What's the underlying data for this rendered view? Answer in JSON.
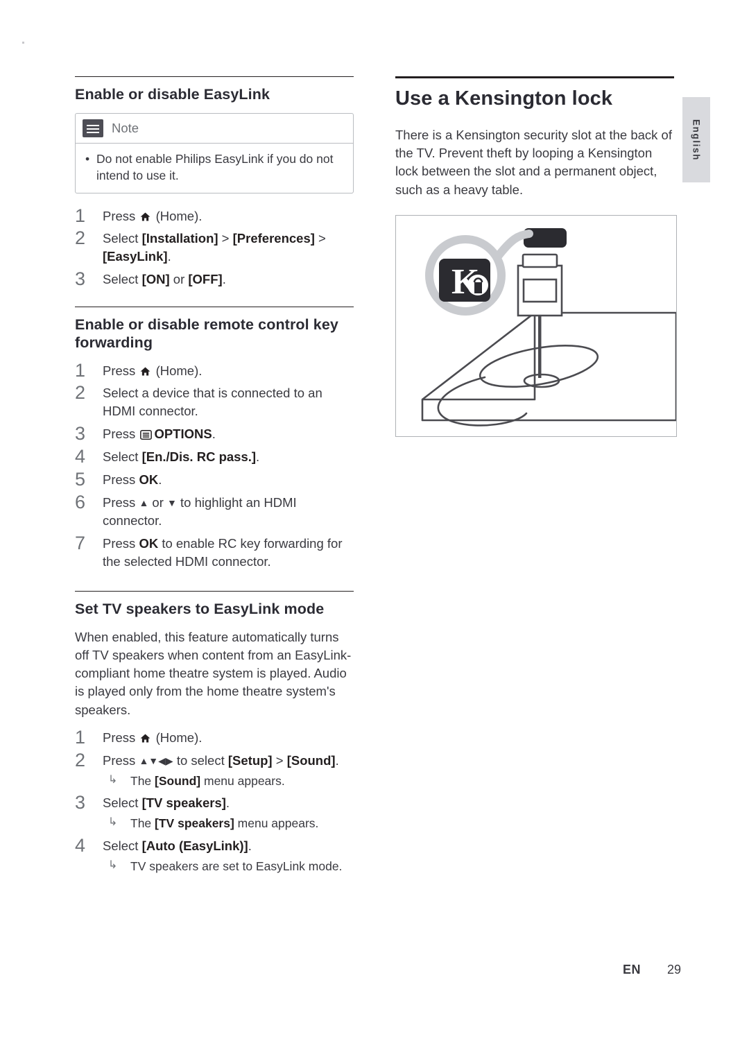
{
  "page": {
    "language_tab": "English",
    "footer_locale": "EN",
    "footer_page": "29"
  },
  "left_column": {
    "section1": {
      "heading": "Enable or disable EasyLink",
      "note": {
        "title": "Note",
        "bullet": "•",
        "items": [
          "Do not enable Philips EasyLink if you do not intend to use it."
        ]
      },
      "steps": [
        {
          "num": "1",
          "pre": "Press ",
          "icon": "home-icon",
          "post": " (Home)."
        },
        {
          "num": "2",
          "pre": "Select ",
          "bold1": "[Installation]",
          "mid1": " > ",
          "bold2": "[Preferences]",
          "mid2": " > ",
          "bold3": "[EasyLink]",
          "post": "."
        },
        {
          "num": "3",
          "pre": "Select ",
          "bold1": "[ON]",
          "mid1": " or ",
          "bold2": "[OFF]",
          "post": "."
        }
      ]
    },
    "section2": {
      "heading": "Enable or disable remote control key forwarding",
      "steps": [
        {
          "num": "1",
          "pre": "Press ",
          "icon": "home-icon",
          "post": " (Home)."
        },
        {
          "num": "2",
          "pre": "Select a device that is connected to an HDMI connector.",
          "post": ""
        },
        {
          "num": "3",
          "pre": "Press ",
          "icon": "options-icon",
          "bold1": "OPTIONS",
          "post": "."
        },
        {
          "num": "4",
          "pre": "Select ",
          "bold1": "[En./Dis. RC pass.]",
          "post": "."
        },
        {
          "num": "5",
          "pre": "Press ",
          "bold1": "OK",
          "post": "."
        },
        {
          "num": "6",
          "pre": "Press ",
          "icon": "up-down-arrows",
          "post": " to highlight an HDMI connector."
        },
        {
          "num": "7",
          "pre": "Press ",
          "bold1": "OK",
          "post": " to enable RC key forwarding for the selected HDMI connector."
        }
      ]
    },
    "section3": {
      "heading": "Set TV speakers to EasyLink mode",
      "paragraph": "When enabled, this feature automatically turns off TV speakers when content from an EasyLink-compliant home theatre system is played. Audio is played only from the home theatre system's speakers.",
      "steps": [
        {
          "num": "1",
          "pre": "Press ",
          "icon": "home-icon",
          "post": " (Home)."
        },
        {
          "num": "2",
          "pre": "Press ",
          "icon": "nav-arrows",
          "mid0": " to select ",
          "bold1": "[Setup]",
          "mid1": " > ",
          "bold2": "[Sound]",
          "post": ".",
          "sub": {
            "arrow": "↳",
            "pre": "The ",
            "bold1": "[Sound]",
            "post": " menu appears."
          }
        },
        {
          "num": "3",
          "pre": "Select ",
          "bold1": "[TV speakers]",
          "post": ".",
          "sub": {
            "arrow": "↳",
            "pre": "The ",
            "bold1": "[TV speakers]",
            "post": " menu appears."
          }
        },
        {
          "num": "4",
          "pre": "Select ",
          "bold1": "[Auto (EasyLink)]",
          "post": ".",
          "sub": {
            "arrow": "↳",
            "pre": "TV speakers are set to EasyLink mode.",
            "post": ""
          }
        }
      ]
    }
  },
  "right_column": {
    "heading": "Use a Kensington lock",
    "paragraph": "There is a Kensington security slot at the back of the TV. Prevent theft by looping a Kensington lock between the slot and a permanent object, such as a heavy table.",
    "figure_alt": "kensington-lock-diagram"
  }
}
